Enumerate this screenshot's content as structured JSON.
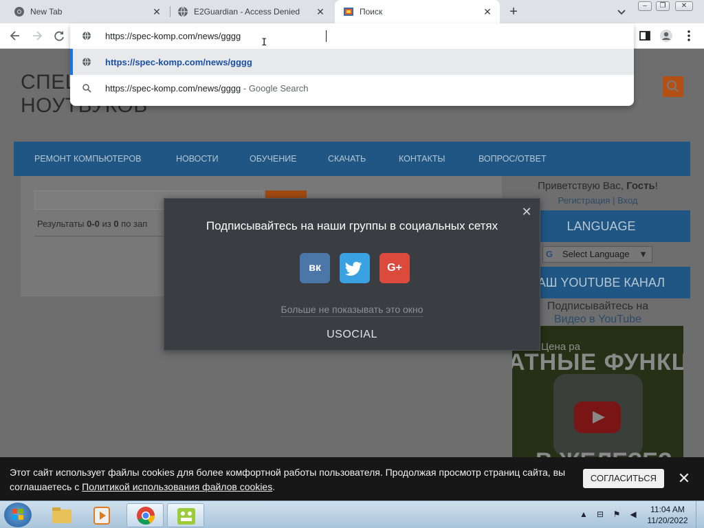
{
  "browser": {
    "tabs": [
      {
        "title": "New Tab",
        "icon": "chrome-icon",
        "active": false
      },
      {
        "title": "E2Guardian - Access Denied",
        "icon": "globe-icon",
        "active": false
      },
      {
        "title": "Поиск",
        "icon": "site-favicon",
        "active": true
      }
    ],
    "new_tab_label": "+",
    "address": "https://spec-komp.com/news/gggg",
    "suggestions": [
      {
        "text": "https://spec-komp.com/news/gggg",
        "description": "",
        "icon": "globe-icon",
        "selected": true
      },
      {
        "text": "https://spec-komp.com/news/gggg",
        "description": " - Google Search",
        "icon": "search-icon",
        "selected": false
      }
    ]
  },
  "site": {
    "title_line1": "СПЕЦ",
    "title_line2": "НОУТБУКОВ",
    "nav": [
      "РЕМОНТ КОМПЬЮТЕРОВ",
      "НОВОСТИ",
      "ОБУЧЕНИЕ",
      "СКАЧАТЬ",
      "КОНТАКТЫ",
      "ВОПРОС/ОТВЕТ"
    ],
    "results": {
      "prefix": "Результаты ",
      "range": "0-0",
      "middle": " из ",
      "total": "0",
      "suffix": " по зап"
    },
    "sidebar": {
      "greeting_prefix": "Приветствую Вас, ",
      "greeting_name": "Гость",
      "greeting_suffix": "!",
      "register_link": "Регистрация",
      "login_link": "Вход",
      "language_heading": "LANGUAGE",
      "language_select": "Select Language",
      "youtube_heading": "АШ YOUTUBE КАНАЛ",
      "youtube_sub_line1": "Подписывайтесь на",
      "youtube_sub_line2": "Видео в YouTube",
      "video_title_small": "Цена ра",
      "video_title_big": "АТНЫЕ ФУНКЦ",
      "video_title_bottom": "В ЖЕЛЕЗЕ?"
    }
  },
  "modal": {
    "title": "Подписывайтесь на наши группы в социальных сетях",
    "networks": [
      {
        "label": "вк",
        "name": "vk",
        "color": "#4a76a8"
      },
      {
        "label": "t",
        "name": "twitter",
        "color": "#3aa1e3"
      },
      {
        "label": "G+",
        "name": "google-plus",
        "color": "#dc4a3d"
      }
    ],
    "dismiss": "Больше не показывать это окно",
    "brand": "USOCIAL"
  },
  "cookie": {
    "text_part1": "Этот сайт использует файлы cookies для более комфортной работы пользователя. Продолжая просмотр страниц сайта, вы соглашаетесь с ",
    "link": "Политикой использования файлов cookies",
    "text_part2": ".",
    "accept": "СОГЛАСИТЬСЯ"
  },
  "taskbar": {
    "time": "11:04 AM",
    "date": "11/20/2022"
  }
}
